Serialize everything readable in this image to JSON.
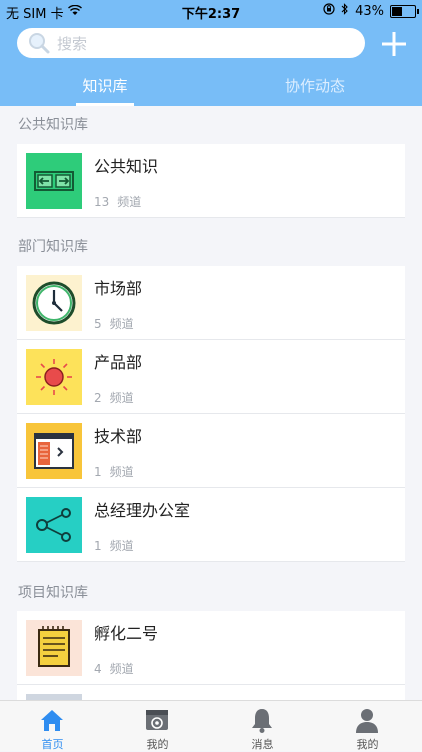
{
  "statusbar": {
    "carrier": "无 SIM 卡",
    "time": "下午2:37",
    "battery_text": "43%"
  },
  "search": {
    "placeholder": "搜索"
  },
  "tabs": {
    "active": "知识库",
    "inactive": "协作动态"
  },
  "sections": {
    "public": {
      "title": "公共知识库",
      "items": [
        {
          "name": "公共知识",
          "count": "13",
          "unit": "频道"
        }
      ]
    },
    "department": {
      "title": "部门知识库",
      "items": [
        {
          "name": "市场部",
          "count": "5",
          "unit": "频道"
        },
        {
          "name": "产品部",
          "count": "2",
          "unit": "频道"
        },
        {
          "name": "技术部",
          "count": "1",
          "unit": "频道"
        },
        {
          "name": "总经理办公室",
          "count": "1",
          "unit": "频道"
        }
      ]
    },
    "project": {
      "title": "项目知识库",
      "items": [
        {
          "name": "孵化二号",
          "count": "4",
          "unit": "频道"
        }
      ]
    }
  },
  "bottom_nav": [
    {
      "label": "首页",
      "icon": "home-icon",
      "active": true
    },
    {
      "label": "我的",
      "icon": "dashboard-icon",
      "active": false
    },
    {
      "label": "消息",
      "icon": "bell-icon",
      "active": false
    },
    {
      "label": "我的",
      "icon": "person-icon",
      "active": false
    }
  ],
  "colors": {
    "header": "#78bdf7",
    "accent": "#2f8df0",
    "background": "#f4f5f9"
  }
}
